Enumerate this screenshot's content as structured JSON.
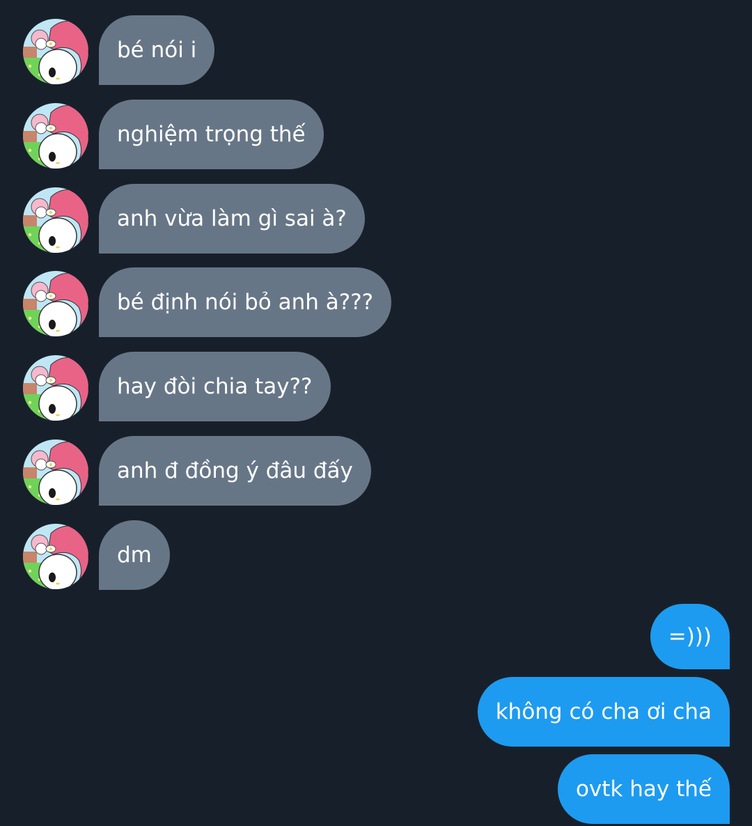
{
  "conversation": {
    "incoming": [
      {
        "text": "bé nói i"
      },
      {
        "text": "nghiệm trọng thế"
      },
      {
        "text": "anh vừa làm gì sai à?"
      },
      {
        "text": "bé định nói bỏ anh à???"
      },
      {
        "text": "hay đòi chia tay??"
      },
      {
        "text": "anh đ đồng ý đâu đấy"
      },
      {
        "text": "dm"
      }
    ],
    "outgoing": [
      {
        "text": "=)))"
      },
      {
        "text": "không có cha ơi cha"
      },
      {
        "text": "ovtk hay thế"
      }
    ]
  },
  "colors": {
    "background": "#17202a",
    "incoming_bubble": "#677687",
    "outgoing_bubble": "#1d9bf0",
    "text": "#ffffff"
  },
  "avatar": {
    "icon": "my-melody-avatar-icon"
  }
}
